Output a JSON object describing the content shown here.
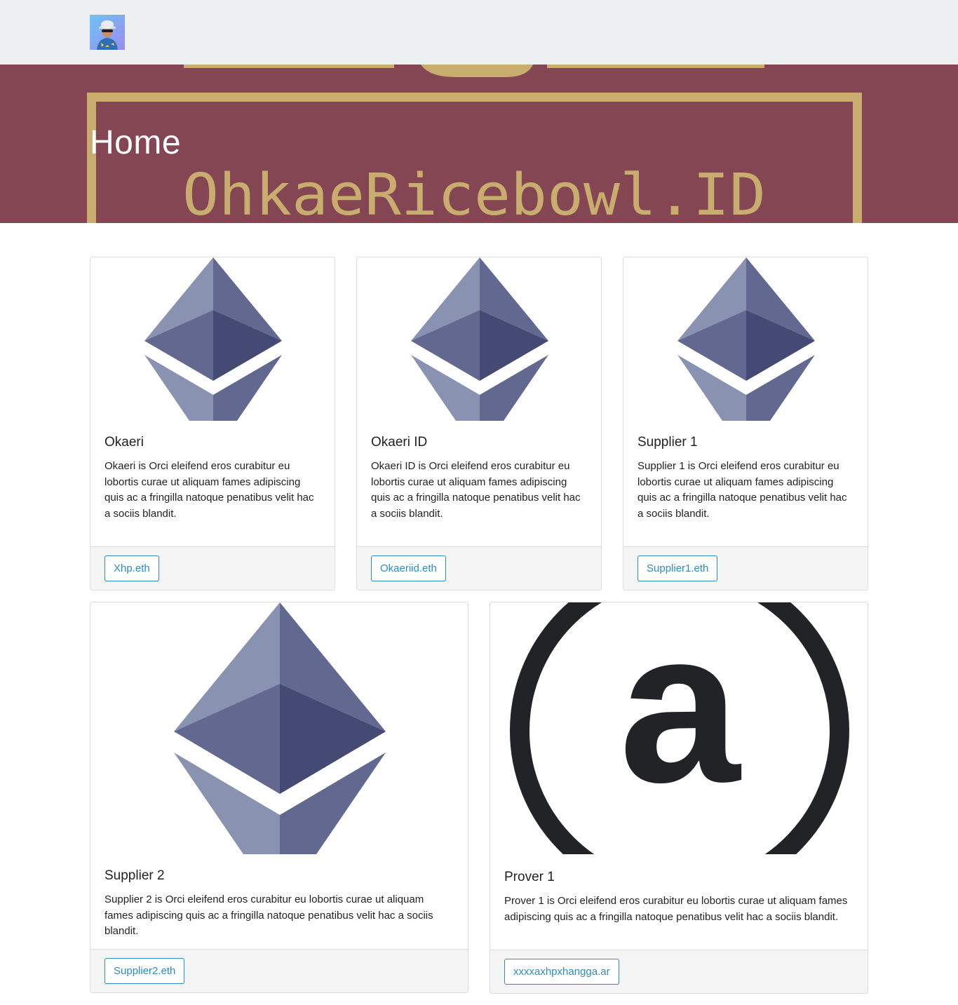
{
  "navbar": {
    "avatar_alt": "profile avatar"
  },
  "hero": {
    "title": "Home",
    "banner_text": "OhkaeRicebowl.ID"
  },
  "cards": [
    {
      "title": "Okaeri",
      "text": "Okaeri is Orci eleifend eros curabitur eu lobortis curae ut aliquam fames adipiscing quis ac a fringilla natoque penatibus velit hac a sociis blandit.",
      "button": "Xhp.eth",
      "icon": "ethereum-logo-icon"
    },
    {
      "title": "Okaeri ID",
      "text": "Okaeri ID is Orci eleifend eros curabitur eu lobortis curae ut aliquam fames adipiscing quis ac a fringilla natoque penatibus velit hac a sociis blandit.",
      "button": "Okaeriid.eth",
      "icon": "ethereum-logo-icon"
    },
    {
      "title": "Supplier 1",
      "text": "Supplier 1 is Orci eleifend eros curabitur eu lobortis curae ut aliquam fames adipiscing quis ac a fringilla natoque penatibus velit hac a sociis blandit.",
      "button": "Supplier1.eth",
      "icon": "ethereum-logo-icon"
    },
    {
      "title": "Supplier 2",
      "text": "Supplier 2 is Orci eleifend eros curabitur eu lobortis curae ut aliquam fames adipiscing quis ac a fringilla natoque penatibus velit hac a sociis blandit.",
      "button": "Supplier2.eth",
      "icon": "ethereum-logo-icon"
    },
    {
      "title": "Prover 1",
      "text": "Prover 1 is Orci eleifend eros curabitur eu lobortis curae ut aliquam fames adipiscing quis ac a fringilla natoque penatibus velit hac a sociis blandit.",
      "button": "xxxxaxhpxhangga.ar",
      "icon": "arweave-logo-icon"
    }
  ],
  "colors": {
    "navbar_bg": "#ecf0f1",
    "hero_bg": "#844652",
    "hero_gold": "#c9ad6e",
    "link_blue": "#2d8bc5",
    "eth_light": "#8a92b2",
    "eth_mid": "#62688f",
    "eth_dark": "#454a75"
  }
}
